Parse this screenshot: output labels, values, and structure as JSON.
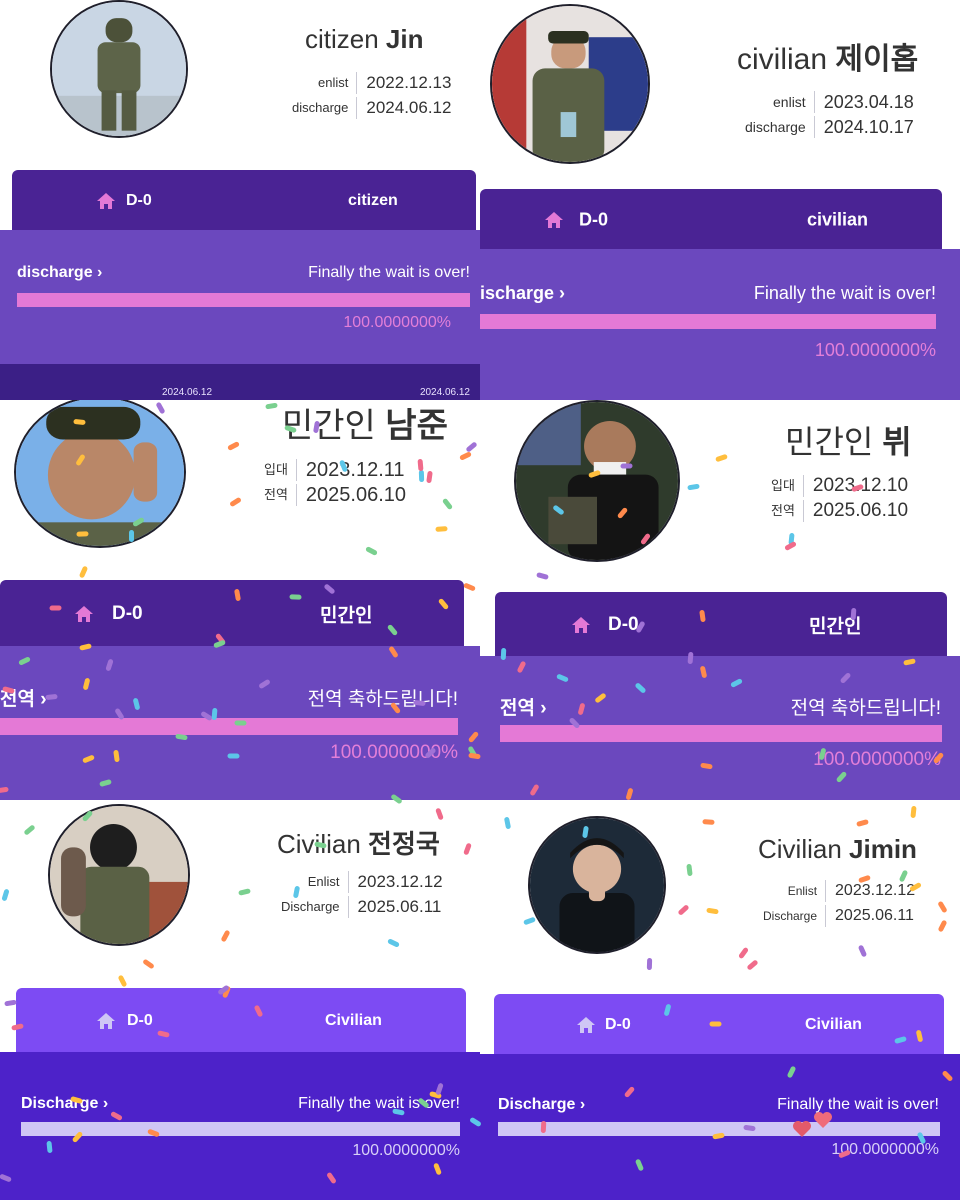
{
  "colors": {
    "dark_purple": "#4a2394",
    "mid_purple": "#6b48be",
    "bright_purple": "#7d4bf3",
    "indigo": "#4d22c9",
    "pink": "#e479d6",
    "pink_text": "#e37fd8",
    "lavender": "#cfc6f5",
    "lavender_text": "#d8d0f7"
  },
  "panels": [
    {
      "title_prefix": "citizen ",
      "title_name": "Jin",
      "enlist_label": "enlist",
      "enlist_date": "2022.12.13",
      "discharge_label": "discharge",
      "discharge_date": "2024.06.12",
      "dday": "D-0",
      "status": "citizen",
      "progress_link": "discharge",
      "progress_message": "Finally the wait is over!",
      "progress_percent_text": "100.0000000%",
      "progress_value": 1.0,
      "footer_date_left": "2024.06.12",
      "footer_date_right": "2024.06.12"
    },
    {
      "title_prefix": "civilian ",
      "title_name": "제이홉",
      "enlist_label": "enlist",
      "enlist_date": "2023.04.18",
      "discharge_label": "discharge",
      "discharge_date": "2024.10.17",
      "dday": "D-0",
      "status": "civilian",
      "progress_link": "ischarge",
      "progress_message": "Finally the wait is over!",
      "progress_percent_text": "100.0000000%",
      "progress_value": 1.0
    },
    {
      "title_prefix": "민간인 ",
      "title_name": "남준",
      "enlist_label": "입대",
      "enlist_date": "2023.12.11",
      "discharge_label": "전역",
      "discharge_date": "2025.06.10",
      "dday": "D-0",
      "status": "민간인",
      "progress_link": "전역",
      "progress_message": "전역 축하드립니다!",
      "progress_percent_text": "100.0000000%",
      "progress_value": 1.0
    },
    {
      "title_prefix": "민간인 ",
      "title_name": "뷔",
      "enlist_label": "입대",
      "enlist_date": "2023.12.10",
      "discharge_label": "전역",
      "discharge_date": "2025.06.10",
      "dday": "D-0",
      "status": "민간인",
      "progress_link": "전역",
      "progress_message": "전역 축하드립니다!",
      "progress_percent_text": "100.0000000%",
      "progress_value": 1.0
    },
    {
      "title_prefix": "Civilian ",
      "title_name": "전정국",
      "enlist_label": "Enlist",
      "enlist_date": "2023.12.12",
      "discharge_label": "Discharge",
      "discharge_date": "2025.06.11",
      "dday": "D-0",
      "status": "Civilian",
      "progress_link": "Discharge",
      "progress_message": "Finally the wait is over!",
      "progress_percent_text": "100.0000000%",
      "progress_value": 1.0
    },
    {
      "title_prefix": "Civilian ",
      "title_name": "Jimin",
      "enlist_label": "Enlist",
      "enlist_date": "2023.12.12",
      "discharge_label": "Discharge",
      "discharge_date": "2025.06.11",
      "dday": "D-0",
      "status": "Civilian",
      "progress_link": "Discharge",
      "progress_message": "Finally the wait is over!",
      "progress_percent_text": "100.0000000%",
      "progress_value": 1.0
    }
  ],
  "confetti_colors": [
    "#f06b8b",
    "#5cc6e8",
    "#ffbe3d",
    "#7ad08f",
    "#a072d6",
    "#ff8a4c"
  ]
}
